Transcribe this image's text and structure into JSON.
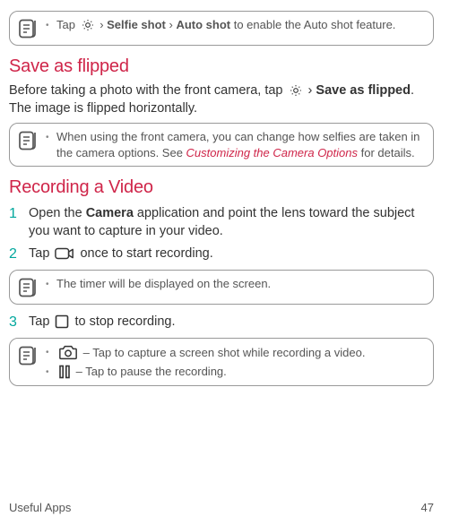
{
  "noteA": {
    "line1_pre": "Tap ",
    "line1_chev": " › ",
    "line1_b1": "Selfie shot",
    "line1_chev2": " › ",
    "line1_b2": "Auto shot",
    "line1_post": " to enable the Auto shot feature."
  },
  "sectionB": {
    "title": "Save as flipped",
    "body_pre": "Before taking a photo with the front camera, tap ",
    "body_chev": " › ",
    "body_bold": "Save as flipped",
    "body_post": ". The image is flipped horizontally."
  },
  "noteB": {
    "text_pre": "When using the front camera, you can change how selfies are taken in the camera options. See ",
    "link": "Customizing the Camera Options",
    "text_post": " for details."
  },
  "sectionC": {
    "title": "Recording a Video",
    "steps": [
      {
        "num": "1",
        "pre": "Open the ",
        "bold": "Camera",
        "post": " application and point the lens toward the subject you want to capture in your video."
      },
      {
        "num": "2",
        "pre": "Tap ",
        "post": " once to start recording."
      },
      {
        "num": "3",
        "pre": "Tap ",
        "post": " to stop recording."
      }
    ]
  },
  "noteC": {
    "text": "The timer will be displayed on the screen."
  },
  "noteD": {
    "i1_post": " – Tap to capture a screen shot while recording a video.",
    "i2_post": " – Tap to pause the recording."
  },
  "footer": {
    "left": "Useful Apps",
    "right": "47"
  }
}
